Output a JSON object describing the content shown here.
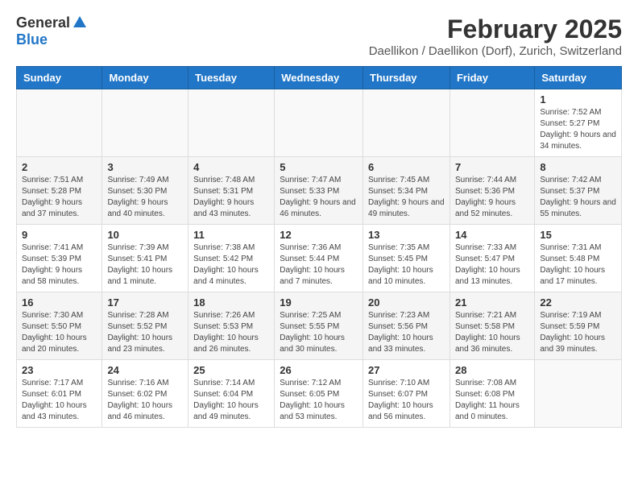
{
  "header": {
    "logo_general": "General",
    "logo_blue": "Blue",
    "month_year": "February 2025",
    "location": "Daellikon / Daellikon (Dorf), Zurich, Switzerland"
  },
  "days_of_week": [
    "Sunday",
    "Monday",
    "Tuesday",
    "Wednesday",
    "Thursday",
    "Friday",
    "Saturday"
  ],
  "weeks": [
    [
      {
        "day": "",
        "info": ""
      },
      {
        "day": "",
        "info": ""
      },
      {
        "day": "",
        "info": ""
      },
      {
        "day": "",
        "info": ""
      },
      {
        "day": "",
        "info": ""
      },
      {
        "day": "",
        "info": ""
      },
      {
        "day": "1",
        "info": "Sunrise: 7:52 AM\nSunset: 5:27 PM\nDaylight: 9 hours and 34 minutes."
      }
    ],
    [
      {
        "day": "2",
        "info": "Sunrise: 7:51 AM\nSunset: 5:28 PM\nDaylight: 9 hours and 37 minutes."
      },
      {
        "day": "3",
        "info": "Sunrise: 7:49 AM\nSunset: 5:30 PM\nDaylight: 9 hours and 40 minutes."
      },
      {
        "day": "4",
        "info": "Sunrise: 7:48 AM\nSunset: 5:31 PM\nDaylight: 9 hours and 43 minutes."
      },
      {
        "day": "5",
        "info": "Sunrise: 7:47 AM\nSunset: 5:33 PM\nDaylight: 9 hours and 46 minutes."
      },
      {
        "day": "6",
        "info": "Sunrise: 7:45 AM\nSunset: 5:34 PM\nDaylight: 9 hours and 49 minutes."
      },
      {
        "day": "7",
        "info": "Sunrise: 7:44 AM\nSunset: 5:36 PM\nDaylight: 9 hours and 52 minutes."
      },
      {
        "day": "8",
        "info": "Sunrise: 7:42 AM\nSunset: 5:37 PM\nDaylight: 9 hours and 55 minutes."
      }
    ],
    [
      {
        "day": "9",
        "info": "Sunrise: 7:41 AM\nSunset: 5:39 PM\nDaylight: 9 hours and 58 minutes."
      },
      {
        "day": "10",
        "info": "Sunrise: 7:39 AM\nSunset: 5:41 PM\nDaylight: 10 hours and 1 minute."
      },
      {
        "day": "11",
        "info": "Sunrise: 7:38 AM\nSunset: 5:42 PM\nDaylight: 10 hours and 4 minutes."
      },
      {
        "day": "12",
        "info": "Sunrise: 7:36 AM\nSunset: 5:44 PM\nDaylight: 10 hours and 7 minutes."
      },
      {
        "day": "13",
        "info": "Sunrise: 7:35 AM\nSunset: 5:45 PM\nDaylight: 10 hours and 10 minutes."
      },
      {
        "day": "14",
        "info": "Sunrise: 7:33 AM\nSunset: 5:47 PM\nDaylight: 10 hours and 13 minutes."
      },
      {
        "day": "15",
        "info": "Sunrise: 7:31 AM\nSunset: 5:48 PM\nDaylight: 10 hours and 17 minutes."
      }
    ],
    [
      {
        "day": "16",
        "info": "Sunrise: 7:30 AM\nSunset: 5:50 PM\nDaylight: 10 hours and 20 minutes."
      },
      {
        "day": "17",
        "info": "Sunrise: 7:28 AM\nSunset: 5:52 PM\nDaylight: 10 hours and 23 minutes."
      },
      {
        "day": "18",
        "info": "Sunrise: 7:26 AM\nSunset: 5:53 PM\nDaylight: 10 hours and 26 minutes."
      },
      {
        "day": "19",
        "info": "Sunrise: 7:25 AM\nSunset: 5:55 PM\nDaylight: 10 hours and 30 minutes."
      },
      {
        "day": "20",
        "info": "Sunrise: 7:23 AM\nSunset: 5:56 PM\nDaylight: 10 hours and 33 minutes."
      },
      {
        "day": "21",
        "info": "Sunrise: 7:21 AM\nSunset: 5:58 PM\nDaylight: 10 hours and 36 minutes."
      },
      {
        "day": "22",
        "info": "Sunrise: 7:19 AM\nSunset: 5:59 PM\nDaylight: 10 hours and 39 minutes."
      }
    ],
    [
      {
        "day": "23",
        "info": "Sunrise: 7:17 AM\nSunset: 6:01 PM\nDaylight: 10 hours and 43 minutes."
      },
      {
        "day": "24",
        "info": "Sunrise: 7:16 AM\nSunset: 6:02 PM\nDaylight: 10 hours and 46 minutes."
      },
      {
        "day": "25",
        "info": "Sunrise: 7:14 AM\nSunset: 6:04 PM\nDaylight: 10 hours and 49 minutes."
      },
      {
        "day": "26",
        "info": "Sunrise: 7:12 AM\nSunset: 6:05 PM\nDaylight: 10 hours and 53 minutes."
      },
      {
        "day": "27",
        "info": "Sunrise: 7:10 AM\nSunset: 6:07 PM\nDaylight: 10 hours and 56 minutes."
      },
      {
        "day": "28",
        "info": "Sunrise: 7:08 AM\nSunset: 6:08 PM\nDaylight: 11 hours and 0 minutes."
      },
      {
        "day": "",
        "info": ""
      }
    ]
  ]
}
